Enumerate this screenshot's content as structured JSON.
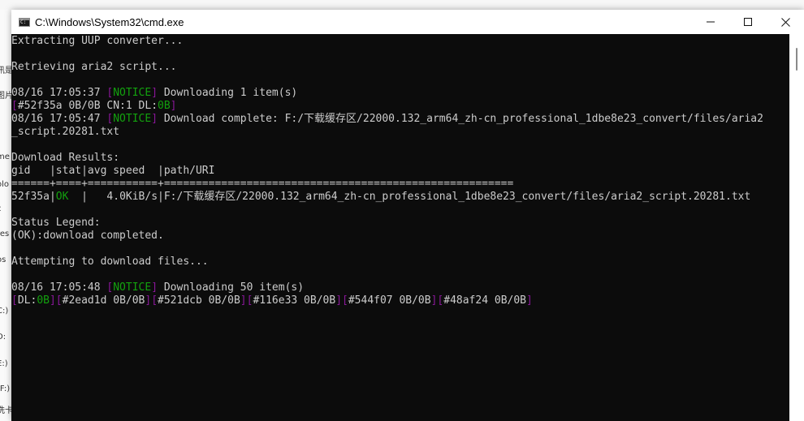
{
  "window": {
    "title": "C:\\Windows\\System32\\cmd.exe"
  },
  "background": {
    "left_fragments": [
      "讯是",
      "图片",
      "me",
      "olo",
      "c",
      "res",
      "os",
      "C:)",
      "D:",
      "E:)",
      "(F:)",
      "洗卡"
    ]
  },
  "terminal": {
    "lines": [
      [
        {
          "t": "Extracting UUP converter..."
        }
      ],
      [],
      [
        {
          "t": "Retrieving aria2 script..."
        }
      ],
      [],
      [
        {
          "t": "08/16 17:05:37 "
        },
        {
          "t": "[",
          "c": "m"
        },
        {
          "t": "NOTICE",
          "c": "g"
        },
        {
          "t": "]",
          "c": "m"
        },
        {
          "t": " Downloading 1 item(s)"
        }
      ],
      [
        {
          "t": "[",
          "c": "m"
        },
        {
          "t": "#52f35a 0B/0B CN:1 DL:"
        },
        {
          "t": "0B",
          "c": "g"
        },
        {
          "t": "]",
          "c": "m"
        }
      ],
      [
        {
          "t": "08/16 17:05:47 "
        },
        {
          "t": "[",
          "c": "m"
        },
        {
          "t": "NOTICE",
          "c": "g"
        },
        {
          "t": "]",
          "c": "m"
        },
        {
          "t": " Download complete: F:/下载缓存区/22000.132_arm64_zh-cn_professional_1dbe8e23_convert/files/aria2"
        }
      ],
      [
        {
          "t": "_script.20281.txt"
        }
      ],
      [],
      [
        {
          "t": "Download Results:"
        }
      ],
      [
        {
          "t": "gid   |stat|avg speed  |path/URI"
        }
      ],
      [
        {
          "t": "======+====+===========+======================================================="
        }
      ],
      [
        {
          "t": "52f35a|"
        },
        {
          "t": "OK",
          "c": "g"
        },
        {
          "t": "  |   4.0KiB/s|F:/下载缓存区/22000.132_arm64_zh-cn_professional_1dbe8e23_convert/files/aria2_script.20281.txt"
        }
      ],
      [],
      [
        {
          "t": "Status Legend:"
        }
      ],
      [
        {
          "t": "(OK):download completed."
        }
      ],
      [],
      [
        {
          "t": "Attempting to download files..."
        }
      ],
      [],
      [
        {
          "t": "08/16 17:05:48 "
        },
        {
          "t": "[",
          "c": "m"
        },
        {
          "t": "NOTICE",
          "c": "g"
        },
        {
          "t": "]",
          "c": "m"
        },
        {
          "t": " Downloading 50 item(s)"
        }
      ],
      [
        {
          "t": "[",
          "c": "m"
        },
        {
          "t": "DL:"
        },
        {
          "t": "0B",
          "c": "g"
        },
        {
          "t": "][",
          "c": "m"
        },
        {
          "t": "#2ead1d 0B/0B"
        },
        {
          "t": "][",
          "c": "m"
        },
        {
          "t": "#521dcb 0B/0B"
        },
        {
          "t": "][",
          "c": "m"
        },
        {
          "t": "#116e33 0B/0B"
        },
        {
          "t": "][",
          "c": "m"
        },
        {
          "t": "#544f07 0B/0B"
        },
        {
          "t": "][",
          "c": "m"
        },
        {
          "t": "#48af24 0B/0B"
        },
        {
          "t": "]",
          "c": "m"
        }
      ]
    ]
  },
  "colors": {
    "terminal_bg": "#0c0c0c",
    "terminal_fg": "#cccccc",
    "green": "#13a10e",
    "magenta": "#881798"
  },
  "icons": {
    "app": "cmd-icon",
    "minimize": "minimize-icon",
    "maximize": "maximize-icon",
    "close": "close-icon"
  }
}
